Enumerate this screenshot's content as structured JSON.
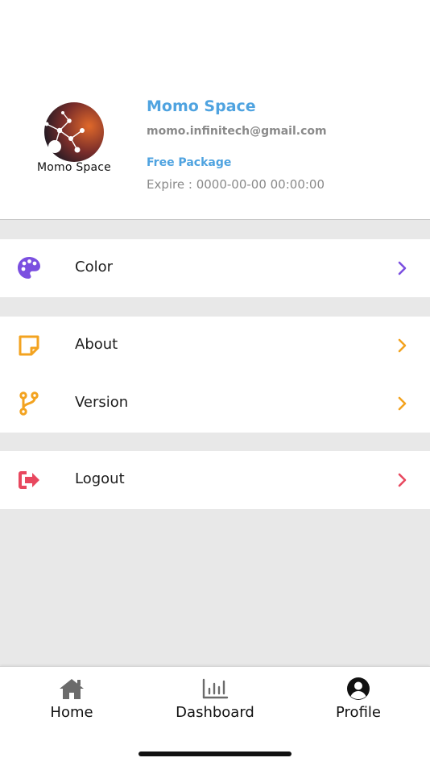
{
  "profile": {
    "logo_text": "Momo Space",
    "name": "Momo Space",
    "email": "momo.infinitech@gmail.com",
    "package": "Free Package",
    "expire": "Expire : 0000-00-00 00:00:00"
  },
  "menu": [
    {
      "label": "Color",
      "icon": "palette-icon",
      "color": "#7b4fe0"
    },
    {
      "label": "About",
      "icon": "sticky-note-icon",
      "color": "#f3a320"
    },
    {
      "label": "Version",
      "icon": "code-branch-icon",
      "color": "#f3a320"
    },
    {
      "label": "Logout",
      "icon": "sign-out-icon",
      "color": "#e8485f"
    }
  ],
  "tabs": [
    {
      "label": "Home",
      "icon": "home-icon"
    },
    {
      "label": "Dashboard",
      "icon": "bar-chart-icon"
    },
    {
      "label": "Profile",
      "icon": "user-circle-icon"
    }
  ],
  "colors": {
    "accent": "#4fa3e0",
    "muted": "#8a8a8a",
    "background": "#e8e8e8"
  }
}
